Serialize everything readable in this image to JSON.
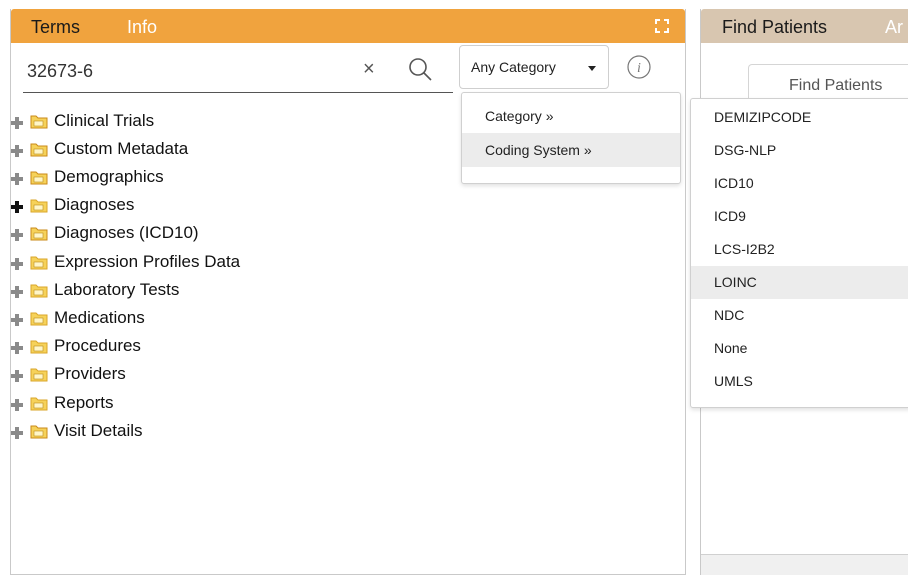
{
  "left_panel": {
    "tabs": {
      "terms": "Terms",
      "info": "Info"
    },
    "search": {
      "value": "32673-6",
      "clear_symbol": "×"
    },
    "category_button": {
      "label": "Any Category"
    },
    "category_menu": [
      "Category »",
      "Coding System »"
    ],
    "tree": [
      {
        "label": "Clinical Trials"
      },
      {
        "label": "Custom Metadata"
      },
      {
        "label": "Demographics"
      },
      {
        "label": "Diagnoses"
      },
      {
        "label": "Diagnoses (ICD10)"
      },
      {
        "label": "Expression Profiles Data"
      },
      {
        "label": "Laboratory Tests"
      },
      {
        "label": "Medications"
      },
      {
        "label": "Procedures"
      },
      {
        "label": "Providers"
      },
      {
        "label": "Reports"
      },
      {
        "label": "Visit Details"
      }
    ]
  },
  "right_panel": {
    "tabs": {
      "find": "Find Patients",
      "partial": "Ar"
    },
    "subtab": "Find Patients"
  },
  "coding_menu": [
    "DEMIZIPCODE",
    "DSG-NLP",
    "ICD10",
    "ICD9",
    "LCS-I2B2",
    "LOINC",
    "NDC",
    "None",
    "UMLS"
  ],
  "colors": {
    "terms_header": "#f0a33e",
    "find_header": "#d8c6b0",
    "menu_highlight": "#ececec"
  }
}
